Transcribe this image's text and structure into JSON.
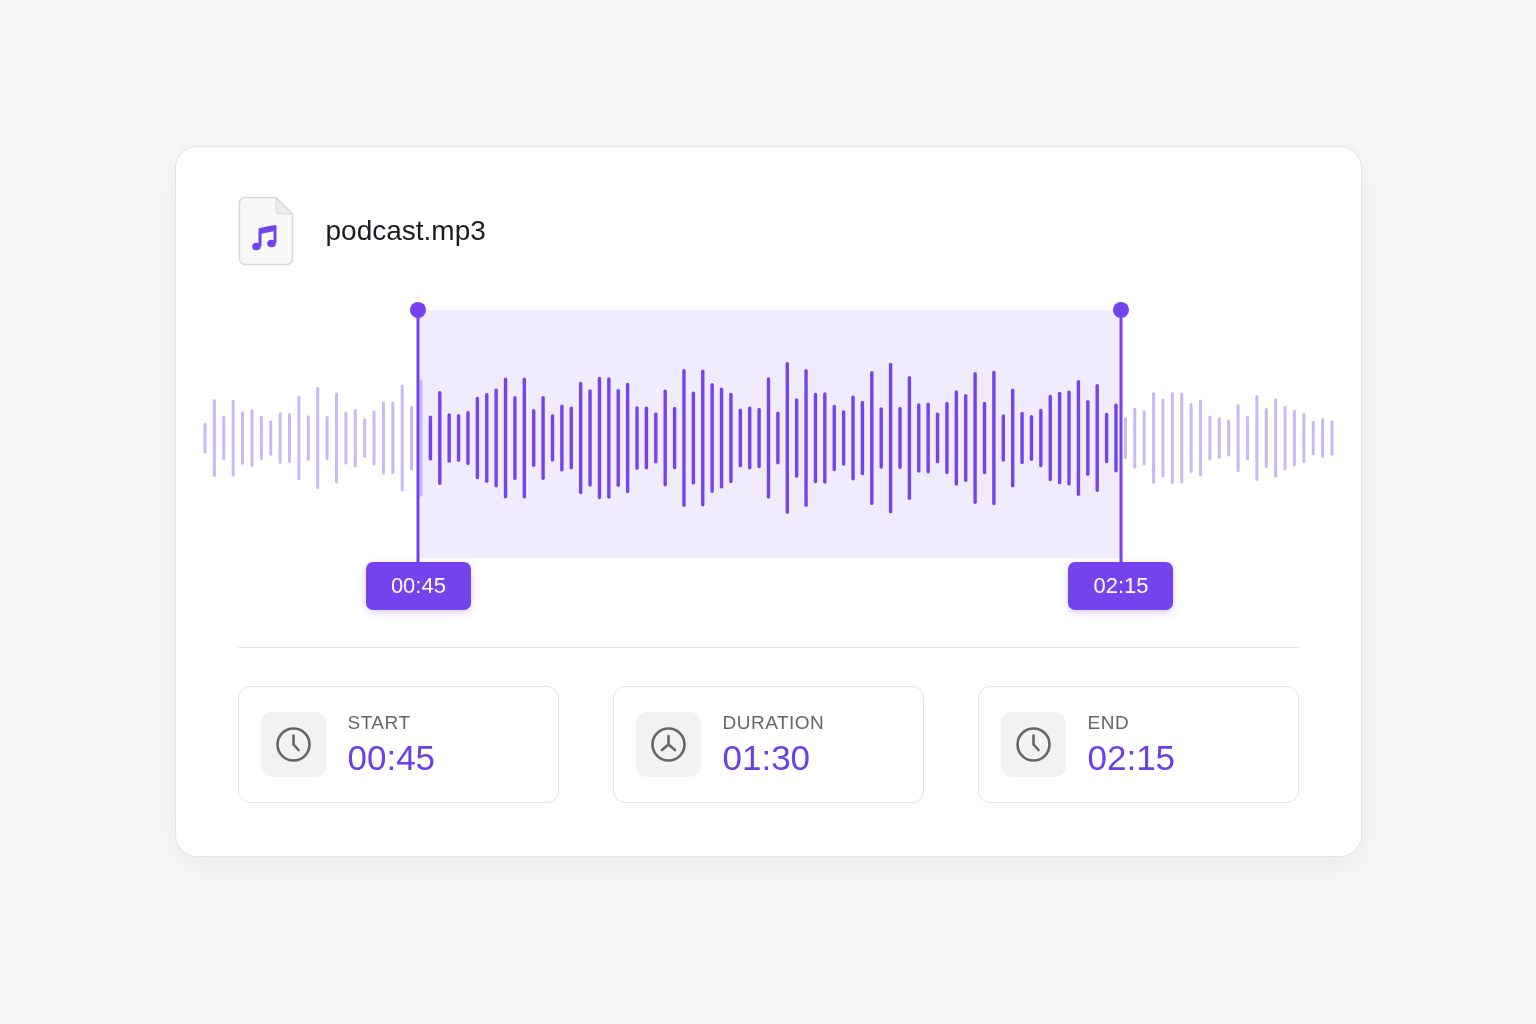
{
  "file": {
    "name": "podcast.mp3"
  },
  "trim": {
    "start": {
      "time": "00:45",
      "level": 0.192
    },
    "end": {
      "time": "02:15",
      "level": 0.811
    }
  },
  "stats": [
    {
      "kind": "clock",
      "label": "START",
      "value": "00:45"
    },
    {
      "kind": "dial",
      "label": "DURATION",
      "value": "01:30"
    },
    {
      "kind": "clock",
      "label": "END",
      "value": "02:15"
    }
  ]
}
